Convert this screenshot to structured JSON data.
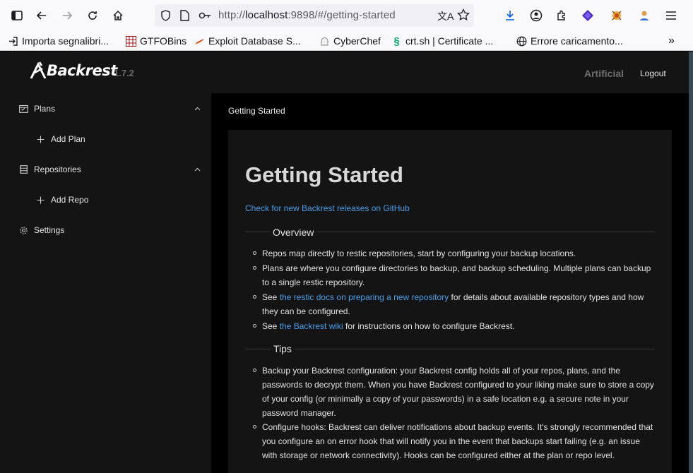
{
  "browser": {
    "url_prefix": "http://",
    "url_host": "localhost",
    "url_rest": ":9898/#/getting-started",
    "bookmarks": [
      {
        "label": "Importa segnalibri...",
        "icon": "import-icon"
      },
      {
        "label": "GTFOBins",
        "icon": "gtfobins-icon"
      },
      {
        "label": "Exploit Database S...",
        "icon": "exploitdb-icon"
      },
      {
        "label": "CyberChef",
        "icon": "cyberchef-icon"
      },
      {
        "label": "crt.sh | Certificate ...",
        "icon": "crtsh-icon"
      },
      {
        "label": "Errore caricamento...",
        "icon": "globe-icon"
      }
    ]
  },
  "header": {
    "logo": "Backrest",
    "version": "1.7.2",
    "user": "Artificial",
    "logout": "Logout"
  },
  "sidebar": {
    "items": [
      {
        "label": "Plans",
        "icon": "calendar-icon"
      },
      {
        "label": "Add Plan",
        "icon": "plus-icon"
      },
      {
        "label": "Repositories",
        "icon": "database-icon"
      },
      {
        "label": "Add Repo",
        "icon": "plus-icon"
      },
      {
        "label": "Settings",
        "icon": "gear-icon"
      }
    ]
  },
  "main": {
    "breadcrumb": "Getting Started",
    "title": "Getting Started",
    "release_link": "Check for new Backrest releases on GitHub",
    "overview": {
      "title": "Overview",
      "items": [
        {
          "line1": "Repos map directly to restic repositories, start by configuring your backup locations."
        },
        {
          "line1": "Plans are where you configure directories to backup, and backup scheduling. Multiple plans can backup",
          "line2": "to a single restic repository."
        },
        {
          "pre": "See ",
          "link": "the restic docs on preparing a new repository",
          "post": " for details about available repository types and how",
          "line2": "they can be configured."
        },
        {
          "pre": "See ",
          "link": "the Backrest wiki",
          "post": " for instructions on how to configure Backrest."
        }
      ]
    },
    "tips": {
      "title": "Tips",
      "items": [
        {
          "lines": [
            "Backup your Backrest configuration: your Backrest config holds all of your repos, plans, and the",
            "passwords to decrypt them. When you have Backrest configured to your liking make sure to store a copy",
            "of your config (or minimally a copy of your passwords) in a safe location e.g. a secure note in your",
            "password manager."
          ]
        },
        {
          "lines": [
            "Configure hooks: Backrest can deliver notifications about backup events. It's strongly recommended that",
            "you configure an on error hook that will notify you in the event that backups start failing (e.g. an issue",
            "with storage or network connectivity). Hooks can be configured either at the plan or repo level."
          ]
        }
      ]
    }
  }
}
